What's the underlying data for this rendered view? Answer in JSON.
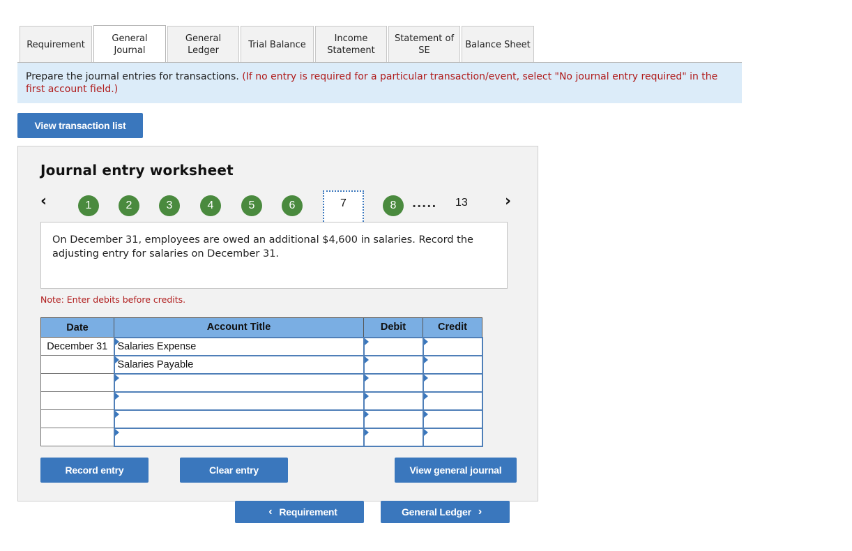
{
  "tabs": [
    {
      "label_line1": "Requirement",
      "label_line2": "",
      "active": false
    },
    {
      "label_line1": "General",
      "label_line2": "Journal",
      "active": true
    },
    {
      "label_line1": "General",
      "label_line2": "Ledger",
      "active": false
    },
    {
      "label_line1": "Trial Balance",
      "label_line2": "",
      "active": false
    },
    {
      "label_line1": "Income",
      "label_line2": "Statement",
      "active": false
    },
    {
      "label_line1": "Statement of",
      "label_line2": "SE",
      "active": false
    },
    {
      "label_line1": "Balance Sheet",
      "label_line2": "",
      "active": false
    }
  ],
  "instruction": {
    "main": "Prepare the journal entries for transactions. ",
    "note": "(If no entry is required for a particular transaction/event, select \"No journal entry required\" in the first account field.)"
  },
  "view_transaction_list_label": "View transaction list",
  "worksheet": {
    "title": "Journal entry worksheet",
    "prev_icon": "chevron-left-icon",
    "next_icon": "chevron-right-icon",
    "steps": [
      "1",
      "2",
      "3",
      "4",
      "5",
      "6"
    ],
    "current_step": "7",
    "next_step": "8",
    "ellipsis": ".....",
    "last_step": "13",
    "question": "On December 31, employees are owed an additional $4,600 in salaries. Record the adjusting entry for salaries on December 31.",
    "note": "Note: Enter debits before credits.",
    "table": {
      "headers": {
        "date": "Date",
        "account": "Account Title",
        "debit": "Debit",
        "credit": "Credit"
      },
      "rows": [
        {
          "date": "December 31",
          "account": "Salaries Expense",
          "debit": "",
          "credit": ""
        },
        {
          "date": "",
          "account": "Salaries Payable",
          "debit": "",
          "credit": ""
        },
        {
          "date": "",
          "account": "",
          "debit": "",
          "credit": ""
        },
        {
          "date": "",
          "account": "",
          "debit": "",
          "credit": ""
        },
        {
          "date": "",
          "account": "",
          "debit": "",
          "credit": ""
        },
        {
          "date": "",
          "account": "",
          "debit": "",
          "credit": ""
        }
      ]
    },
    "buttons": {
      "record": "Record entry",
      "clear": "Clear entry",
      "view_general_journal": "View general journal"
    }
  },
  "footer_nav": {
    "prev_label": "Requirement",
    "next_label": "General Ledger"
  }
}
